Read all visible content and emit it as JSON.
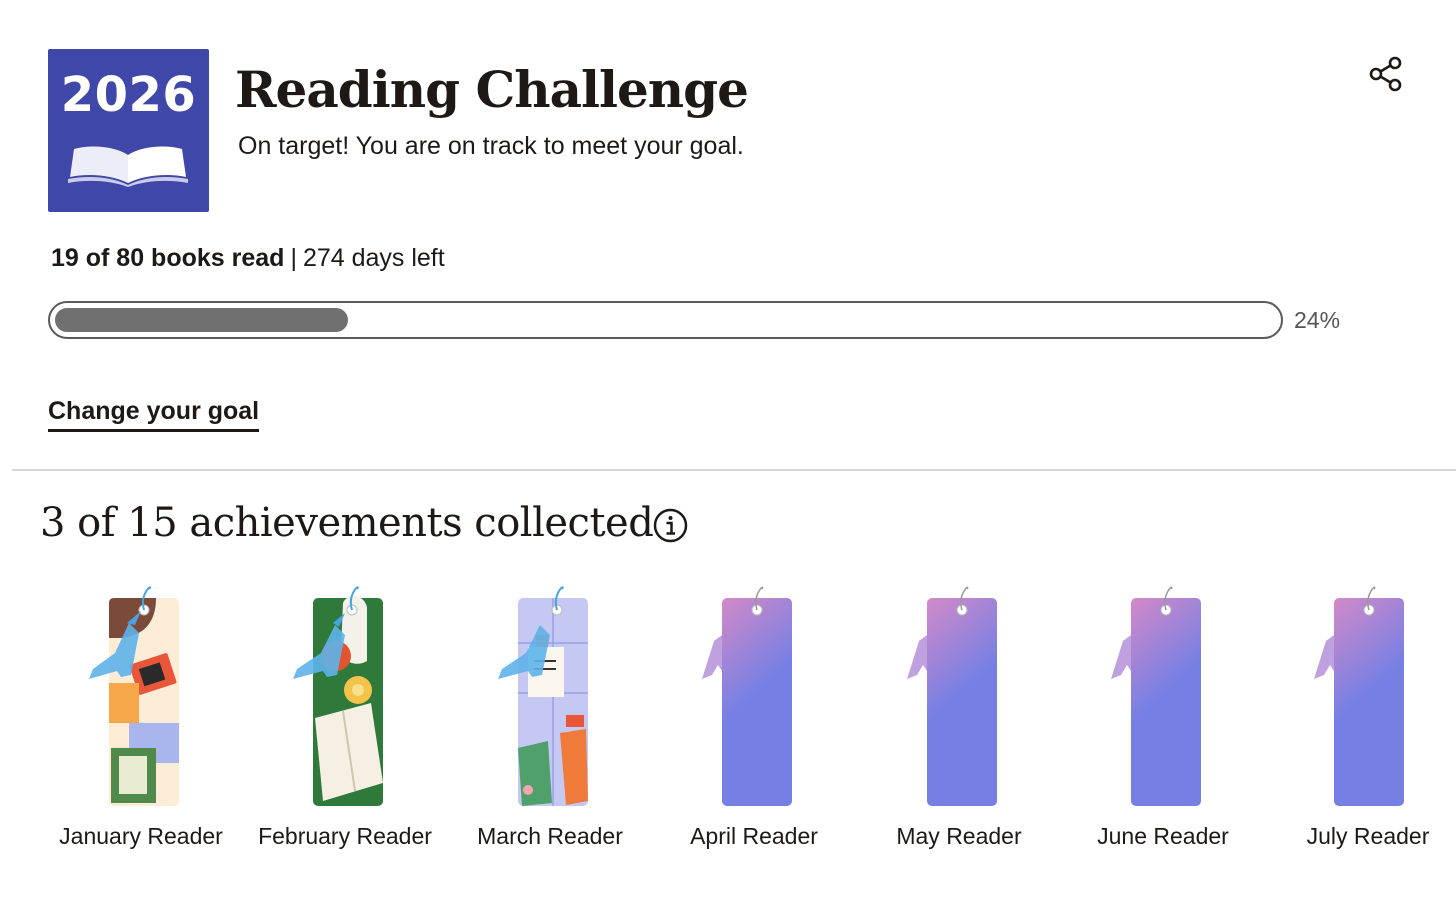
{
  "header": {
    "year": "2026",
    "title": "Reading Challenge",
    "subtitle": "On target! You are on track to meet your goal."
  },
  "progress": {
    "books_read_text": "19 of 80 books read",
    "separator": "|",
    "days_left_text": "274 days left",
    "percent_label": "24%",
    "fill_fraction": 0.24
  },
  "actions": {
    "change_goal": "Change your goal",
    "share_icon": "share-icon",
    "info_icon": "info-icon"
  },
  "achievements": {
    "title": "3 of 15 achievements collected",
    "items": [
      {
        "label": "January Reader",
        "earned": true,
        "theme": "january"
      },
      {
        "label": "February Reader",
        "earned": true,
        "theme": "february"
      },
      {
        "label": "March Reader",
        "earned": true,
        "theme": "march"
      },
      {
        "label": "April Reader",
        "earned": false,
        "theme": "locked"
      },
      {
        "label": "May Reader",
        "earned": false,
        "theme": "locked"
      },
      {
        "label": "June Reader",
        "earned": false,
        "theme": "locked"
      },
      {
        "label": "July Reader",
        "earned": false,
        "theme": "locked"
      }
    ]
  },
  "colors": {
    "badge_bg": "#3f47a8",
    "tassel_earned": "#4aa3e0",
    "tassel_locked": "#b08ad8",
    "locked_top": "#d389c8",
    "locked_bottom": "#7680e4"
  }
}
